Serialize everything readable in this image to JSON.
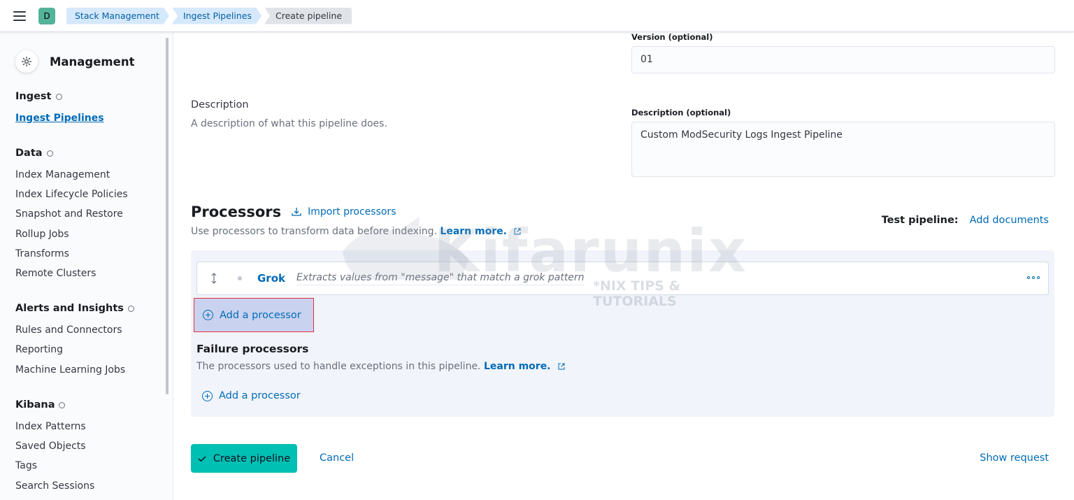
{
  "header": {
    "space_initial": "D",
    "breadcrumbs": [
      "Stack Management",
      "Ingest Pipelines",
      "Create pipeline"
    ]
  },
  "sidebar": {
    "title": "Management",
    "groups": [
      {
        "label": "Ingest",
        "items": [
          "Ingest Pipelines"
        ]
      },
      {
        "label": "Data",
        "items": [
          "Index Management",
          "Index Lifecycle Policies",
          "Snapshot and Restore",
          "Rollup Jobs",
          "Transforms",
          "Remote Clusters"
        ]
      },
      {
        "label": "Alerts and Insights",
        "items": [
          "Rules and Connectors",
          "Reporting",
          "Machine Learning Jobs"
        ]
      },
      {
        "label": "Kibana",
        "items": [
          "Index Patterns",
          "Saved Objects",
          "Tags",
          "Search Sessions"
        ]
      }
    ],
    "active_item": "Ingest Pipelines"
  },
  "form": {
    "version_label": "Version (optional)",
    "version_value": "01",
    "description_title": "Description",
    "description_help": "A description of what this pipeline does.",
    "description_label": "Description (optional)",
    "description_value": "Custom ModSecurity Logs Ingest Pipeline"
  },
  "processors": {
    "title": "Processors",
    "import_label": "Import processors",
    "subtitle": "Use processors to transform data before indexing.",
    "learn_more": "Learn more.",
    "test_pipeline_label": "Test pipeline:",
    "add_documents_label": "Add documents",
    "items": [
      {
        "name": "Grok",
        "description": "Extracts values from \"message\" that match a grok pattern"
      }
    ],
    "add_processor_label": "Add a processor"
  },
  "failure_processors": {
    "title": "Failure processors",
    "subtitle": "The processors used to handle exceptions in this pipeline.",
    "learn_more": "Learn more.",
    "add_processor_label": "Add a processor"
  },
  "footer": {
    "create_label": "Create pipeline",
    "cancel_label": "Cancel",
    "show_request_label": "Show request"
  },
  "watermark": {
    "text": "Kifarunix",
    "subtitle": "*NIX TIPS & TUTORIALS"
  },
  "colors": {
    "accent": "#006bb8",
    "primary_button": "#00bfb3",
    "highlight_border": "#e0323b"
  }
}
